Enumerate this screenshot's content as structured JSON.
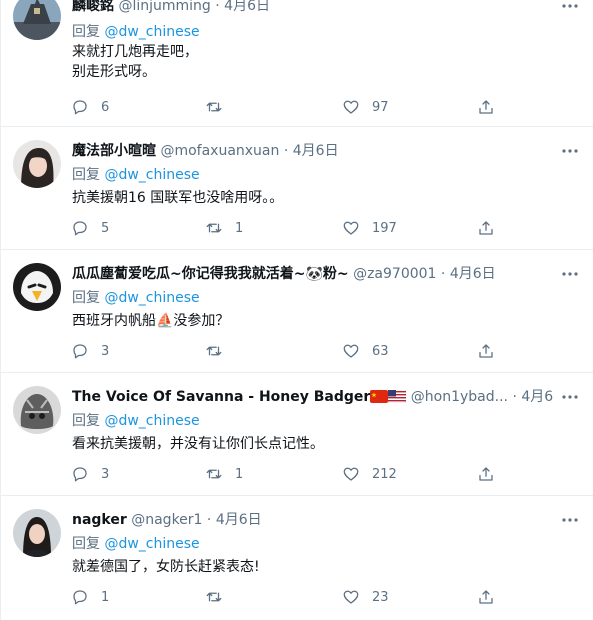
{
  "reply_prefix": "回复",
  "tweets": [
    {
      "name": "麟峻銘",
      "handle": "@linjumming",
      "dot": "·",
      "date": "4月6日",
      "mention": "@dw_chinese",
      "text": "来就打几炮再走吧，\n别走形式呀。",
      "replies": "6",
      "retweets": "",
      "likes": "97"
    },
    {
      "name": "魔法部小暄暄",
      "handle": "@mofaxuanxuan",
      "dot": "·",
      "date": "4月6日",
      "mention": "@dw_chinese",
      "text": "抗美援朝16 国联军也没啥用呀。。",
      "replies": "5",
      "retweets": "1",
      "likes": "197"
    },
    {
      "name": "瓜瓜塵蔔爱吃瓜~你记得我我就活着~🐼粉~",
      "handle": "@za970001",
      "dot": "·",
      "date": "4月6日",
      "mention": "@dw_chinese",
      "text": "西班牙内帆船⛵没参加？",
      "replies": "3",
      "retweets": "",
      "likes": "63"
    },
    {
      "name": "The Voice Of Savanna - Honey Badger",
      "handle": "@hon1ybad...",
      "dot": "·",
      "date": "4月6日",
      "mention": "@dw_chinese",
      "text": "看来抗美援朝，并没有让你们长点记性。",
      "replies": "3",
      "retweets": "1",
      "likes": "212"
    },
    {
      "name": "nagker",
      "handle": "@nagker1",
      "dot": "·",
      "date": "4月6日",
      "mention": "@dw_chinese",
      "text": "就差德国了，女防长赶紧表态!",
      "replies": "1",
      "retweets": "",
      "likes": "23"
    }
  ],
  "icons": {
    "more": "more-dots-icon",
    "reply": "reply-bubble-icon",
    "retweet": "retweet-arrows-icon",
    "like": "heart-icon",
    "share": "share-upload-icon"
  },
  "colors": {
    "text": "#0f1419",
    "secondary": "#5b7083",
    "mention": "#1b95e0",
    "divider": "#ebeef0"
  }
}
